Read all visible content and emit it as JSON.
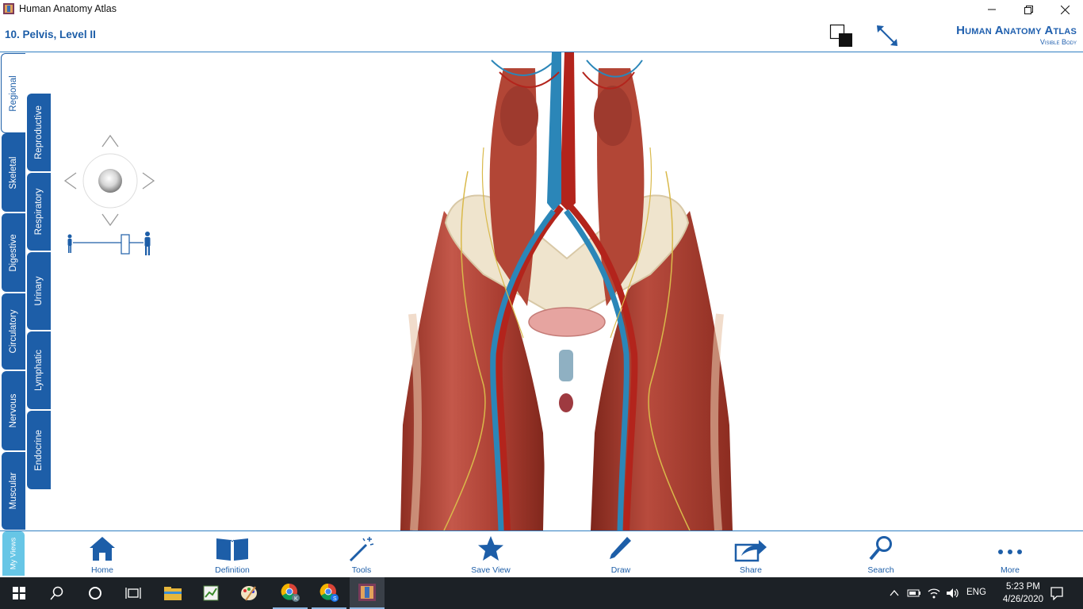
{
  "window": {
    "title": "Human Anatomy Atlas",
    "controls": [
      "minimize-icon",
      "restore-icon",
      "close-icon"
    ]
  },
  "header": {
    "page_title": "10. Pelvis, Level II",
    "brand_line1": "Human Anatomy Atlas",
    "brand_line2": "Visible Body",
    "icons": [
      "contrast-toggle-icon",
      "fullscreen-expand-icon"
    ]
  },
  "tabs_outer": [
    {
      "label": "Regional",
      "active": true
    },
    {
      "label": "Skeletal"
    },
    {
      "label": "Digestive"
    },
    {
      "label": "Circulatory"
    },
    {
      "label": "Nervous"
    },
    {
      "label": "Muscular"
    }
  ],
  "tabs_inner": [
    {
      "label": "Reproductive"
    },
    {
      "label": "Respiratory"
    },
    {
      "label": "Urinary"
    },
    {
      "label": "Lymphatic"
    },
    {
      "label": "Endocrine"
    }
  ],
  "my_views": "My Views",
  "toolbar": [
    {
      "label": "Home",
      "icon": "home-icon"
    },
    {
      "label": "Definition",
      "icon": "book-icon"
    },
    {
      "label": "Tools",
      "icon": "magic-wand-icon"
    },
    {
      "label": "Save View",
      "icon": "star-icon"
    },
    {
      "label": "Draw",
      "icon": "pencil-icon"
    },
    {
      "label": "Share",
      "icon": "share-icon"
    },
    {
      "label": "Search",
      "icon": "search-icon"
    },
    {
      "label": "More",
      "icon": "more-dots-icon"
    }
  ],
  "taskbar": {
    "lang": "ENG",
    "time": "5:23 PM",
    "date": "4/26/2020"
  },
  "colors": {
    "accent": "#1d5ea8",
    "my_views": "#67c6e6",
    "taskbar": "#1c2126"
  }
}
